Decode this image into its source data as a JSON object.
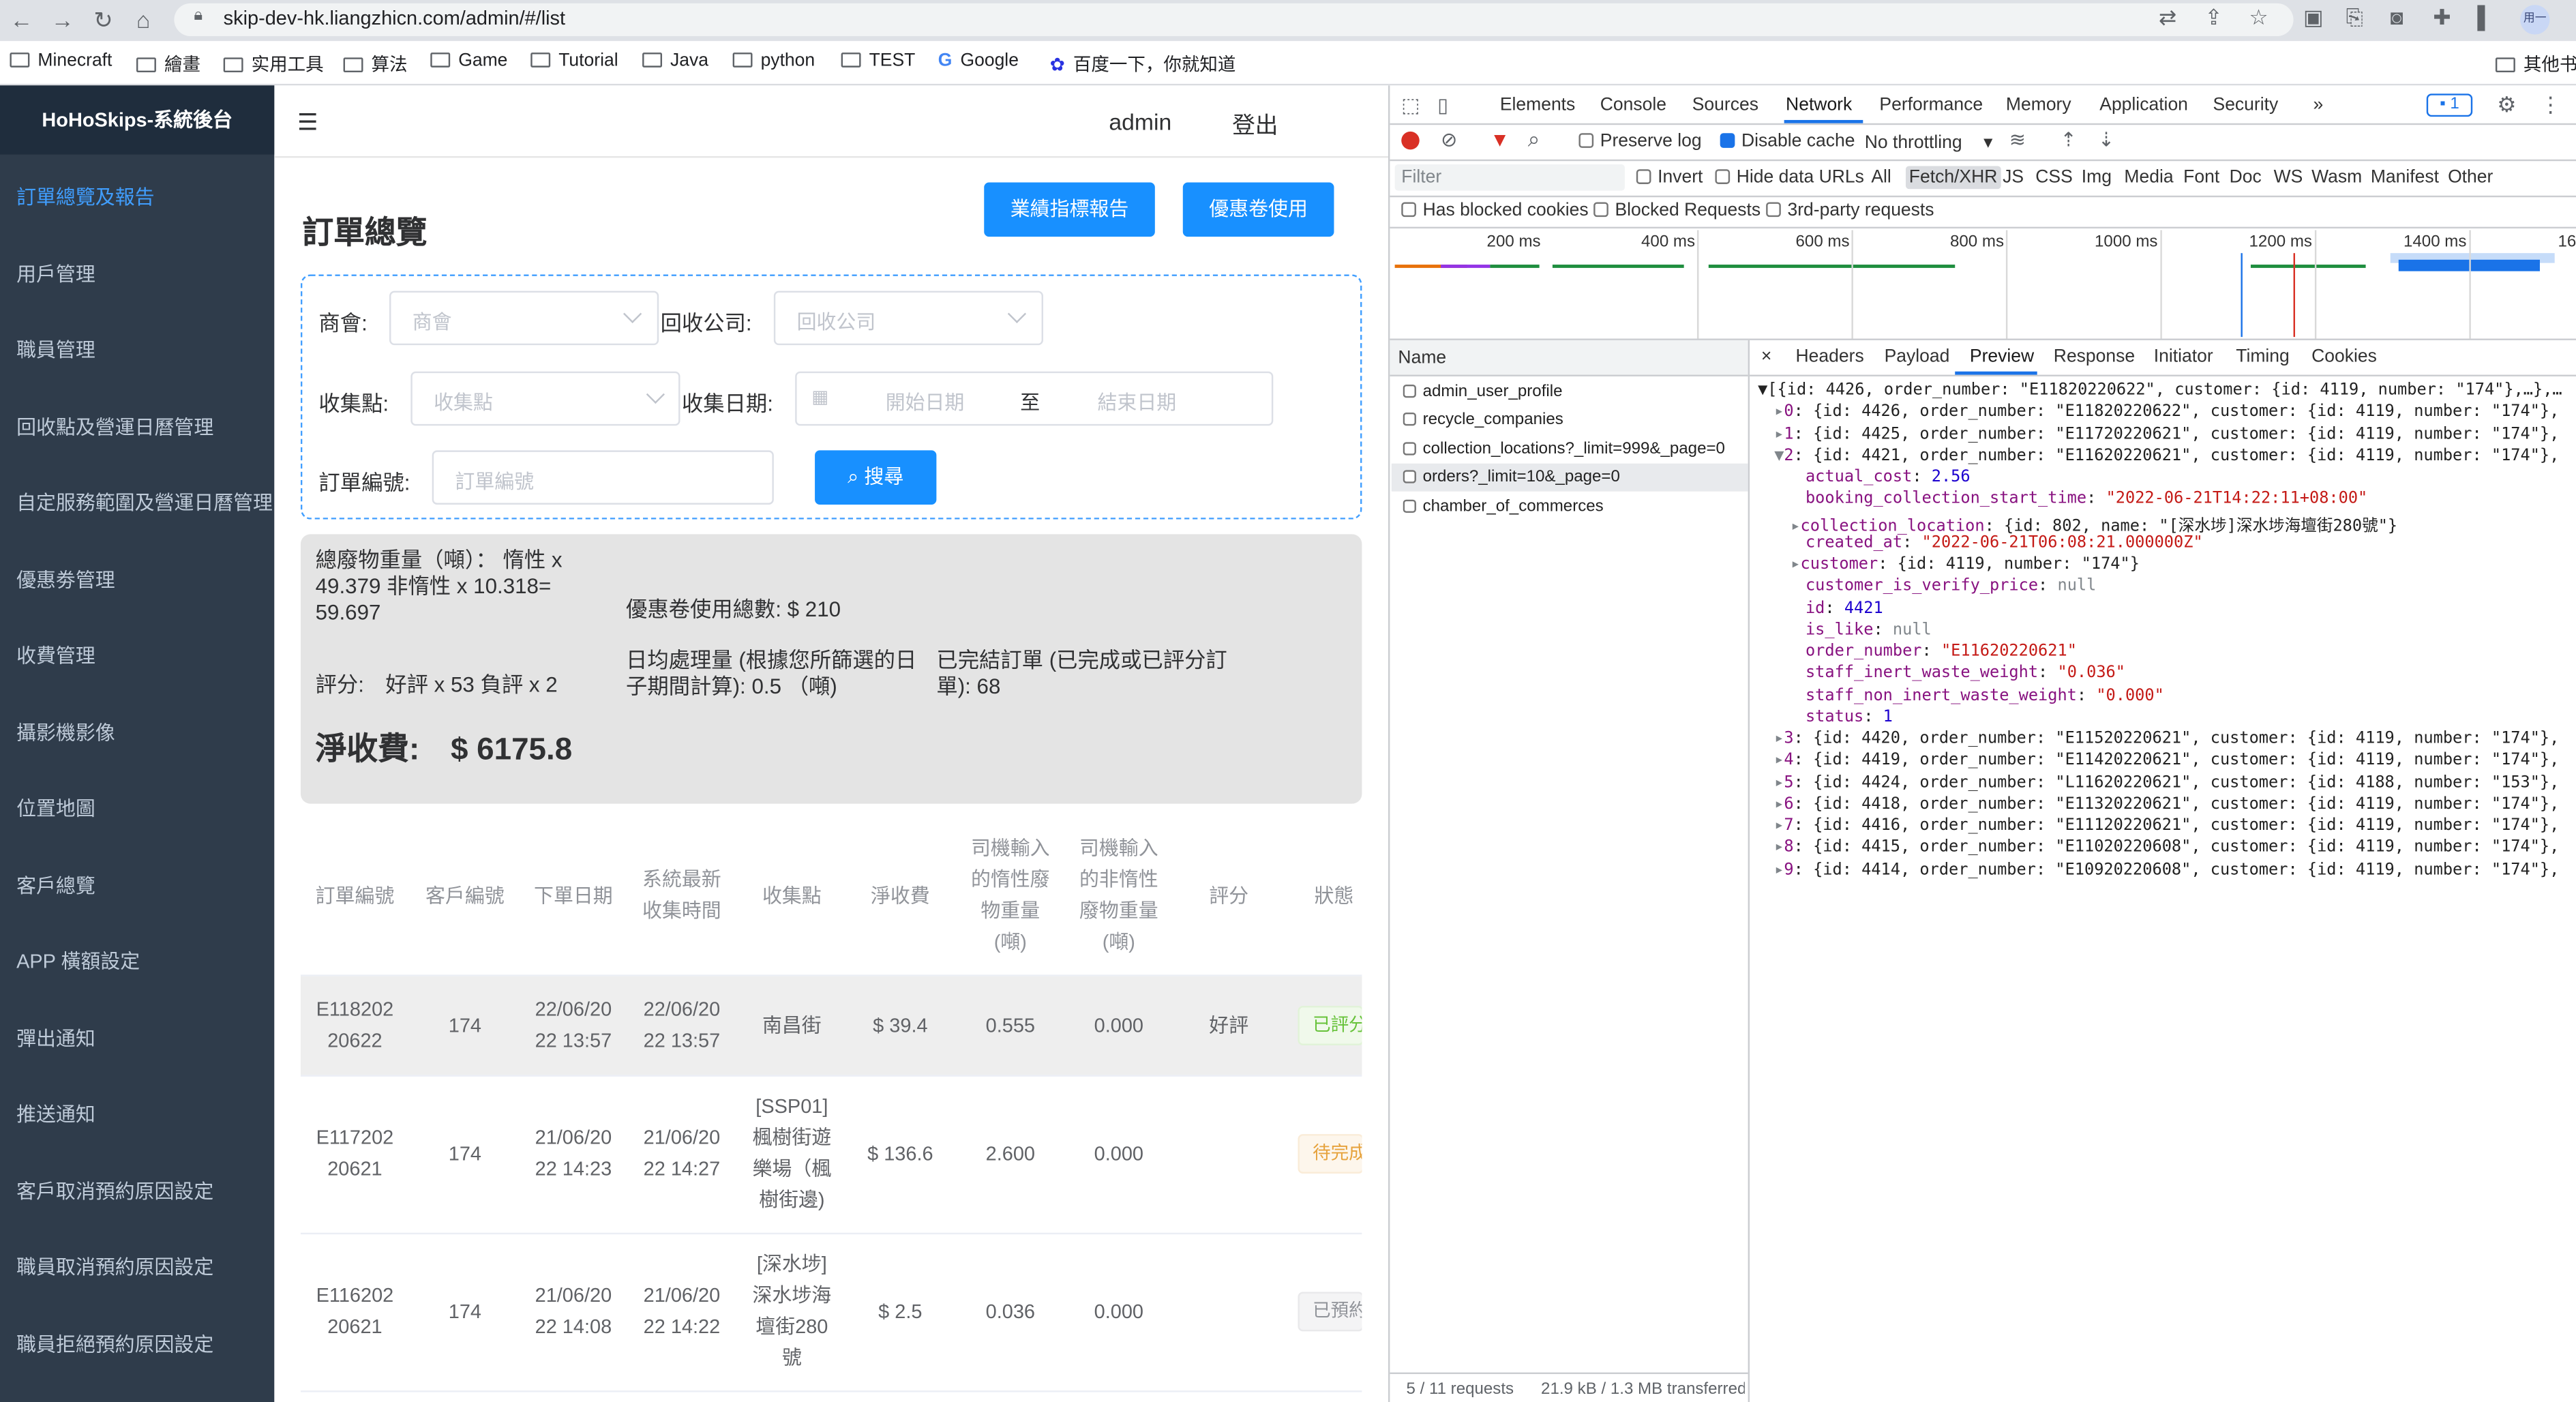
{
  "browser": {
    "url": "skip-dev-hk.liangzhicn.com/admin/#/list",
    "profile": "用一",
    "bookmarks": [
      "Minecraft",
      "繪畫",
      "实用工具",
      "算法",
      "Game",
      "Tutorial",
      "Java",
      "python",
      "TEST",
      "Google",
      "百度一下，你就知道",
      "其他书"
    ]
  },
  "app": {
    "brand": "HoHoSkips-系統後台",
    "admin_name": "admin",
    "logout": "登出"
  },
  "sidebar": {
    "items": [
      "訂單總覽及報告",
      "用戶管理",
      "職員管理",
      "回收點及營運日曆管理",
      "自定服務範圍及營運日曆管理",
      "優惠劵管理",
      "收費管理",
      "攝影機影像",
      "位置地圖",
      "客戶總覽",
      "APP 橫額設定",
      "彈出通知",
      "推送通知",
      "客戶取消預約原因設定",
      "職員取消預約原因設定",
      "職員拒絕預約原因設定"
    ]
  },
  "page": {
    "title": "訂單總覽",
    "btn_report": "業績指標報告",
    "btn_coupon": "優惠卷使用"
  },
  "filters": {
    "chamber_label": "商會:",
    "chamber_placeholder": "商會",
    "recycle_label": "回收公司:",
    "recycle_placeholder": "回收公司",
    "point_label": "收集點:",
    "point_placeholder": "收集點",
    "date_label": "收集日期:",
    "start_placeholder": "開始日期",
    "date_sep": "至",
    "end_placeholder": "結束日期",
    "order_label": "訂單編號:",
    "order_placeholder": "訂單編號",
    "search_button": "搜尋"
  },
  "summary": {
    "waste_line1": "總廢物重量（噸）： 惰性 x",
    "waste_line2": "49.379 非惰性 x 10.318=",
    "waste_line3": "59.697",
    "coupon_total": "優惠卷使用總數: $ 210",
    "rating": "評分:　好評 x 53 負評 x 2",
    "daily_line1": "日均處理量 (根據您所篩選的日",
    "daily_line2": "子期間計算): 0.5 （噸)",
    "done_line1": "已完結訂單 (已完成或已評分訂",
    "done_line2": "單): 68",
    "net_fee": "淨收費:　$ 6175.8"
  },
  "table": {
    "headers": [
      [
        "訂單編號"
      ],
      [
        "客戶編號"
      ],
      [
        "下單日期"
      ],
      [
        "系統最新",
        "收集時間"
      ],
      [
        "收集點"
      ],
      [
        "淨收費"
      ],
      [
        "司機輸入",
        "的惰性廢",
        "物重量",
        "(噸)"
      ],
      [
        "司機輸入",
        "的非惰性",
        "廢物重量",
        "(噸)"
      ],
      [
        "評分"
      ],
      [
        "狀態"
      ]
    ],
    "rows": [
      {
        "order_no": [
          "E118202",
          "20622"
        ],
        "customer": "174",
        "order_date": [
          "22/06/20",
          "22 13:57"
        ],
        "collect_time": [
          "22/06/20",
          "22 13:57"
        ],
        "point": [
          "南昌街"
        ],
        "fee": "$ 39.4",
        "inert": "0.555",
        "non_inert": "0.000",
        "rating": "好評",
        "status": "已評分"
      },
      {
        "order_no": [
          "E117202",
          "20621"
        ],
        "customer": "174",
        "order_date": [
          "21/06/20",
          "22 14:23"
        ],
        "collect_time": [
          "21/06/20",
          "22 14:27"
        ],
        "point": [
          "[SSP01]",
          "楓樹街遊",
          "樂場（楓",
          "樹街邊)"
        ],
        "fee": "$ 136.6",
        "inert": "2.600",
        "non_inert": "0.000",
        "rating": "",
        "status": "待完成"
      },
      {
        "order_no": [
          "E116202",
          "20621"
        ],
        "customer": "174",
        "order_date": [
          "21/06/20",
          "22 14:08"
        ],
        "collect_time": [
          "21/06/20",
          "22 14:22"
        ],
        "point": [
          "[深水埗]",
          "深水埗海",
          "壇街280",
          "號"
        ],
        "fee": "$ 2.5",
        "inert": "0.036",
        "non_inert": "0.000",
        "rating": "",
        "status": "已預約"
      }
    ]
  },
  "devtools": {
    "tabs": [
      "Elements",
      "Console",
      "Sources",
      "Network",
      "Performance",
      "Memory",
      "Application",
      "Security",
      "»"
    ],
    "issues_badge": "1",
    "toolbar": {
      "preserve_log": "Preserve log",
      "disable_cache": "Disable cache",
      "throttling": "No throttling"
    },
    "filter_placeholder": "Filter",
    "filter_types": [
      "Invert",
      "Hide data URLs",
      "All",
      "Fetch/XHR",
      "JS",
      "CSS",
      "Img",
      "Media",
      "Font",
      "Doc",
      "WS",
      "Wasm",
      "Manifest",
      "Other"
    ],
    "checks": [
      "Has blocked cookies",
      "Blocked Requests",
      "3rd-party requests"
    ],
    "timeline_ticks": [
      "200 ms",
      "400 ms",
      "600 ms",
      "800 ms",
      "1000 ms",
      "1200 ms",
      "1400 ms",
      "16"
    ],
    "name_header": "Name",
    "requests": [
      "admin_user_profile",
      "recycle_companies",
      "collection_locations?_limit=999&_page=0",
      "orders?_limit=10&_page=0",
      "chamber_of_commerces"
    ],
    "detail_tabs": [
      "×",
      "Headers",
      "Payload",
      "Preview",
      "Response",
      "Initiator",
      "Timing",
      "Cookies"
    ],
    "status_requests": "5 / 11 requests",
    "status_transfer": "21.9 kB / 1.3 MB transferred",
    "json_lines": [
      "▼[{id: 4426, order_number: \"E11820220622\", customer: {id: 4119, number: \"174\"},…},…",
      "▸0: {id: 4426, order_number: \"E11820220622\", customer: {id: 4119, number: \"174\"},",
      "▸1: {id: 4425, order_number: \"E11720220621\", customer: {id: 4119, number: \"174\"},",
      "▼2: {id: 4421, order_number: \"E11620220621\", customer: {id: 4119, number: \"174\"},",
      "actual_cost: 2.56",
      "booking_collection_start_time: \"2022-06-21T14:22:11+08:00\"",
      "▸collection_location: {id: 802, name: \"[深水埗]深水埗海壇街280號\"}",
      "created_at: \"2022-06-21T06:08:21.000000Z\"",
      "▸customer: {id: 4119, number: \"174\"}",
      "customer_is_verify_price: null",
      "id: 4421",
      "is_like: null",
      "order_number: \"E11620220621\"",
      "staff_inert_waste_weight: \"0.036\"",
      "staff_non_inert_waste_weight: \"0.000\"",
      "status: 1",
      "▸3: {id: 4420, order_number: \"E11520220621\", customer: {id: 4119, number: \"174\"},",
      "▸4: {id: 4419, order_number: \"E11420220621\", customer: {id: 4119, number: \"174\"},",
      "▸5: {id: 4424, order_number: \"L11620220621\", customer: {id: 4188, number: \"153\"},",
      "▸6: {id: 4418, order_number: \"E11320220621\", customer: {id: 4119, number: \"174\"},",
      "▸7: {id: 4416, order_number: \"E11120220621\", customer: {id: 4119, number: \"174\"},",
      "▸8: {id: 4415, order_number: \"E11020220608\", customer: {id: 4119, number: \"174\"},",
      "▸9: {id: 4414, order_number: \"E10920220608\", customer: {id: 4119, number: \"174\"},"
    ]
  },
  "colors": {
    "sidebar_bg": "#2f3c4b",
    "accent_blue": "#1890ff",
    "active_menu": "#409eff",
    "tag_rated": "#67c23a",
    "tag_pending": "#e6a23c",
    "tag_booked": "#909399"
  }
}
